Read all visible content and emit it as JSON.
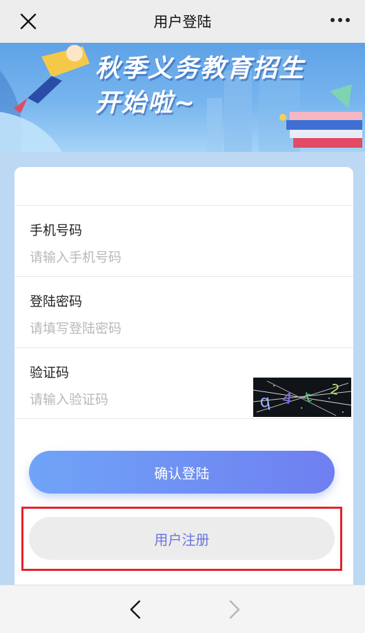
{
  "header": {
    "title": "用户登陆"
  },
  "banner": {
    "line1": "秋季义务教育招生",
    "line2": "开始啦~"
  },
  "form": {
    "phone": {
      "label": "手机号码",
      "placeholder": "请输入手机号码",
      "value": ""
    },
    "password": {
      "label": "登陆密码",
      "placeholder": "请填写登陆密码",
      "value": ""
    },
    "captcha": {
      "label": "验证码",
      "placeholder": "请输入验证码",
      "value": "",
      "image_text": "q4t2"
    }
  },
  "buttons": {
    "login": "确认登陆",
    "register": "用户注册"
  },
  "colors": {
    "accent": "#6f7ff0",
    "highlight": "#e5202a",
    "page_bg": "#bcd8f3"
  },
  "icons": {
    "close": "close-icon",
    "more": "more-icon",
    "back": "chevron-left-icon",
    "forward": "chevron-right-icon"
  }
}
